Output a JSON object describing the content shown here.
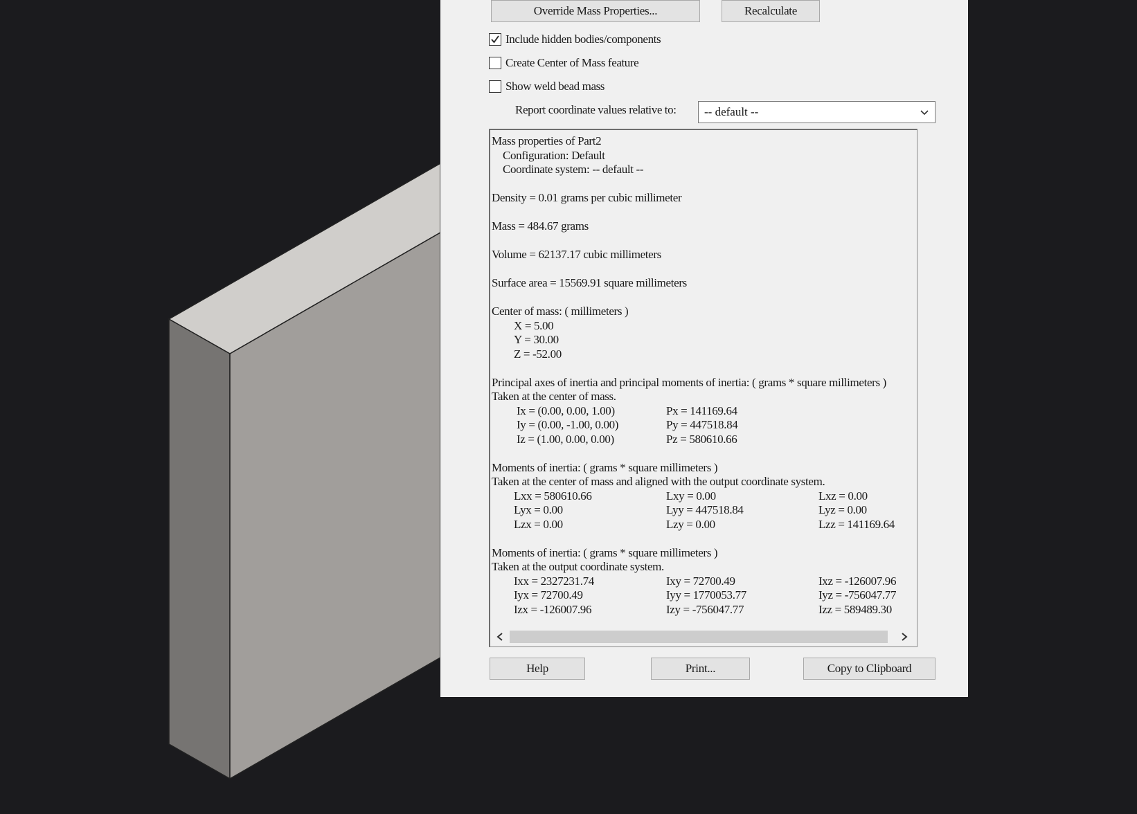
{
  "dialog": {
    "buttons": {
      "override": "Override Mass Properties...",
      "recalculate": "Recalculate",
      "help": "Help",
      "print": "Print...",
      "copy": "Copy to Clipboard"
    },
    "checkboxes": [
      {
        "label": "Include hidden bodies/components",
        "checked": true
      },
      {
        "label": "Create Center of Mass feature",
        "checked": false
      },
      {
        "label": "Show weld bead mass",
        "checked": false
      }
    ],
    "report_label": "Report coordinate values relative to:",
    "report_value": "-- default --",
    "results": {
      "header": "Mass properties of Part2",
      "configuration": "Configuration: Default",
      "coordinate_system": "Coordinate system: -- default --",
      "density": "Density = 0.01 grams per cubic millimeter",
      "mass": "Mass = 484.67 grams",
      "volume": "Volume = 62137.17 cubic millimeters",
      "surface_area": "Surface area = 15569.91  square millimeters",
      "com_title": "Center of mass: ( millimeters )",
      "com": [
        "X = 5.00",
        "Y = 30.00",
        "Z = -52.00"
      ],
      "principal_title": "Principal axes of inertia and principal moments of inertia: ( grams *  square millimeters )",
      "principal_sub": "Taken at the center of mass.",
      "principal_rows": [
        [
          "Ix = (0.00, 0.00, 1.00)",
          "Px = 141169.64"
        ],
        [
          "Iy = (0.00, -1.00, 0.00)",
          "Py = 447518.84"
        ],
        [
          "Iz = (1.00, 0.00, 0.00)",
          "Pz = 580610.66"
        ]
      ],
      "moments1_title": "Moments of inertia: ( grams *  square millimeters )",
      "moments1_sub": "Taken at the center of mass and aligned with the output coordinate system.",
      "moments1_rows": [
        [
          "Lxx = 580610.66",
          "Lxy = 0.00",
          "Lxz = 0.00"
        ],
        [
          "Lyx = 0.00",
          "Lyy = 447518.84",
          "Lyz = 0.00"
        ],
        [
          "Lzx = 0.00",
          "Lzy = 0.00",
          "Lzz = 141169.64"
        ]
      ],
      "moments2_title": "Moments of inertia: ( grams *  square millimeters )",
      "moments2_sub": "Taken at the output coordinate system.",
      "moments2_rows": [
        [
          "Ixx = 2327231.74",
          "Ixy = 72700.49",
          "Ixz = -126007.96"
        ],
        [
          "Iyx = 72700.49",
          "Iyy = 1770053.77",
          "Iyz = -756047.77"
        ],
        [
          "Izx = -126007.96",
          "Izy = -756047.77",
          "Izz = 589489.30"
        ]
      ]
    }
  },
  "colors": {
    "background": "#1b1b1e",
    "dialog": "#f0f0f0",
    "box_top": "#d0cecb",
    "box_front": "#a19e9b",
    "box_side": "#767472"
  }
}
